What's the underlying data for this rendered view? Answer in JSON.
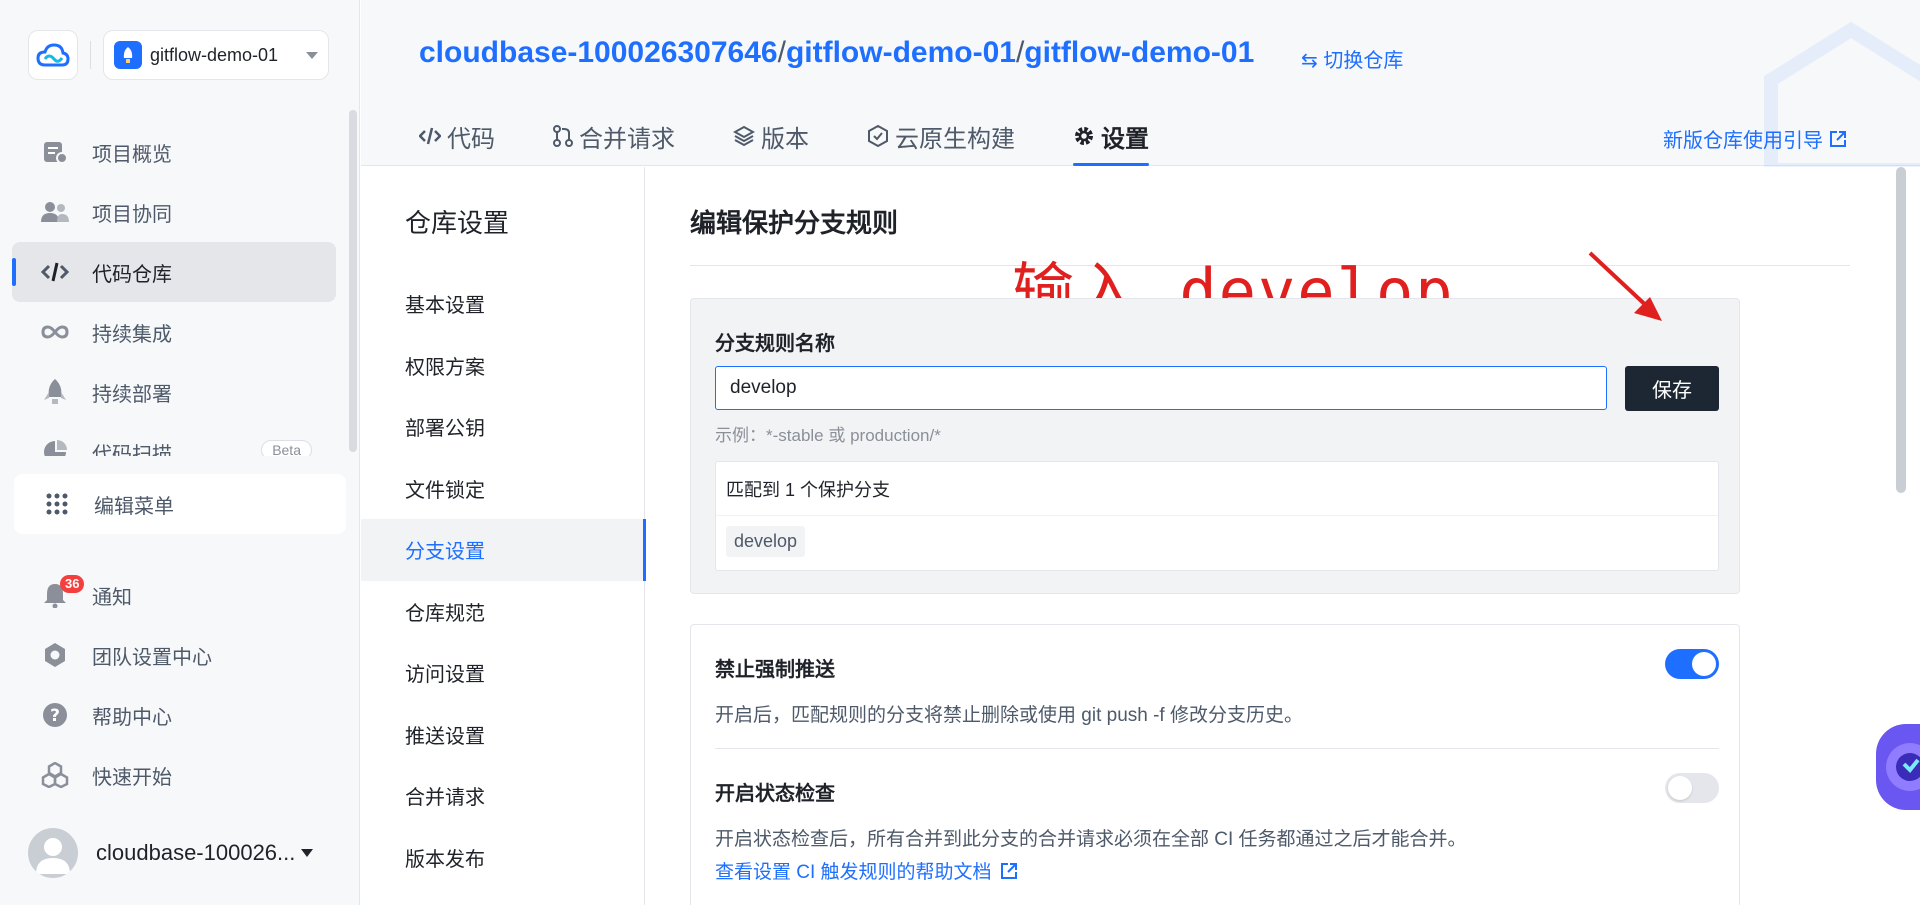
{
  "sidebar": {
    "project_name": "gitflow-demo-01",
    "nav": [
      {
        "label": "项目概览",
        "icon": "overview-icon"
      },
      {
        "label": "项目协同",
        "icon": "team-icon"
      },
      {
        "label": "代码仓库",
        "icon": "code-icon",
        "active": true
      },
      {
        "label": "持续集成",
        "icon": "infinity-icon"
      },
      {
        "label": "持续部署",
        "icon": "rocket-icon"
      },
      {
        "label": "代码扫描",
        "icon": "pie-icon",
        "badge": "Beta"
      }
    ],
    "edit_menu": "编辑菜单",
    "bottom_nav": [
      {
        "label": "通知",
        "icon": "bell-icon",
        "count": "36"
      },
      {
        "label": "团队设置中心",
        "icon": "settings-icon"
      },
      {
        "label": "帮助中心",
        "icon": "help-icon"
      },
      {
        "label": "快速开始",
        "icon": "cube-icon"
      }
    ],
    "user_name": "cloudbase-100026..."
  },
  "header": {
    "repo_owner": "cloudbase-100026307646",
    "repo_group": "gitflow-demo-01",
    "repo_name": "gitflow-demo-01",
    "sep": "/",
    "switch_repo": "切换仓库",
    "tabs": [
      {
        "label": "代码",
        "icon": "code-icon"
      },
      {
        "label": "合并请求",
        "icon": "merge-icon"
      },
      {
        "label": "版本",
        "icon": "layers-icon"
      },
      {
        "label": "云原生构建",
        "icon": "build-icon"
      },
      {
        "label": "设置",
        "icon": "gear-icon",
        "active": true
      }
    ],
    "guide_link": "新版仓库使用引导"
  },
  "settings_nav": {
    "title": "仓库设置",
    "items": [
      "基本设置",
      "权限方案",
      "部署公钥",
      "文件锁定",
      "分支设置",
      "仓库规范",
      "访问设置",
      "推送设置",
      "合并请求",
      "版本发布"
    ],
    "active_index": 4
  },
  "main": {
    "title": "编辑保护分支规则",
    "annotation": "输入 develop",
    "rule_label": "分支规则名称",
    "rule_value": "develop",
    "save_label": "保存",
    "hint": "示例：*-stable 或 production/*",
    "match_text": "匹配到 1 个保护分支",
    "matched_branch": "develop",
    "options": [
      {
        "title": "禁止强制推送",
        "desc": "开启后，匹配规则的分支将禁止删除或使用 git push -f 修改分支历史。",
        "enabled": true
      },
      {
        "title": "开启状态检查",
        "desc": "开启状态检查后，所有合并到此分支的合并请求必须在全部 CI 任务都通过之后才能合并。",
        "link": "查看设置 CI 触发规则的帮助文档",
        "enabled": false
      }
    ]
  },
  "colors": {
    "accent": "#1e6fff",
    "annotation": "#e0201f",
    "save_button": "#1d2733"
  }
}
